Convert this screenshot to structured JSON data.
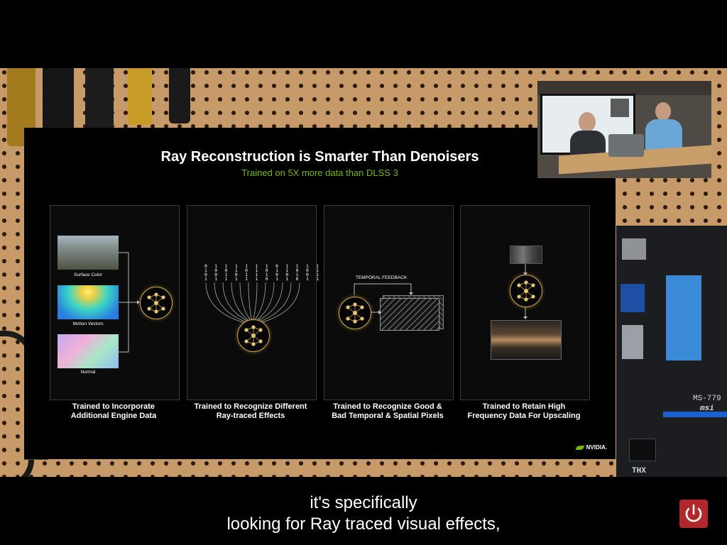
{
  "slide": {
    "title": "Ray Reconstruction is Smarter Than Denoisers",
    "subtitle": "Trained on 5X more data than DLSS 3",
    "panels": [
      {
        "caption": "Trained to Incorporate\nAdditional Engine Data",
        "inputs": [
          "Surface Color",
          "Motion Vectors",
          "Normal"
        ]
      },
      {
        "caption": "Trained to Recognize Different\nRay-traced Effects",
        "bits": [
          "0 1 1 1 1 1 1 0 1 1 1 1",
          "1 0 0 1 0 1 0 1 1 0 0 1",
          "0 0 1 0 1 1 1 0 0 1 0 1",
          "1 1 1 1 1 1 0 1 1 0 1 1"
        ]
      },
      {
        "caption": "Trained to Recognize Good &\nBad Temporal & Spatial Pixels",
        "label": "TEMPORAL FEEDBACK"
      },
      {
        "caption": "Trained to Retain High\nFrequency Data For Upscaling"
      }
    ],
    "brand": "NVIDIA."
  },
  "motherboard": {
    "model": "MS-779",
    "brand": "msi",
    "audio": "THX"
  },
  "subtitles": {
    "line1": "it's specifically",
    "line2": "looking for Ray traced visual effects,"
  },
  "colors": {
    "nvidia_green": "#76b900",
    "gold": "#c8a24a",
    "power_red": "#b0282c"
  },
  "icons": {
    "network": "neural-network-icon",
    "power": "power-icon"
  }
}
